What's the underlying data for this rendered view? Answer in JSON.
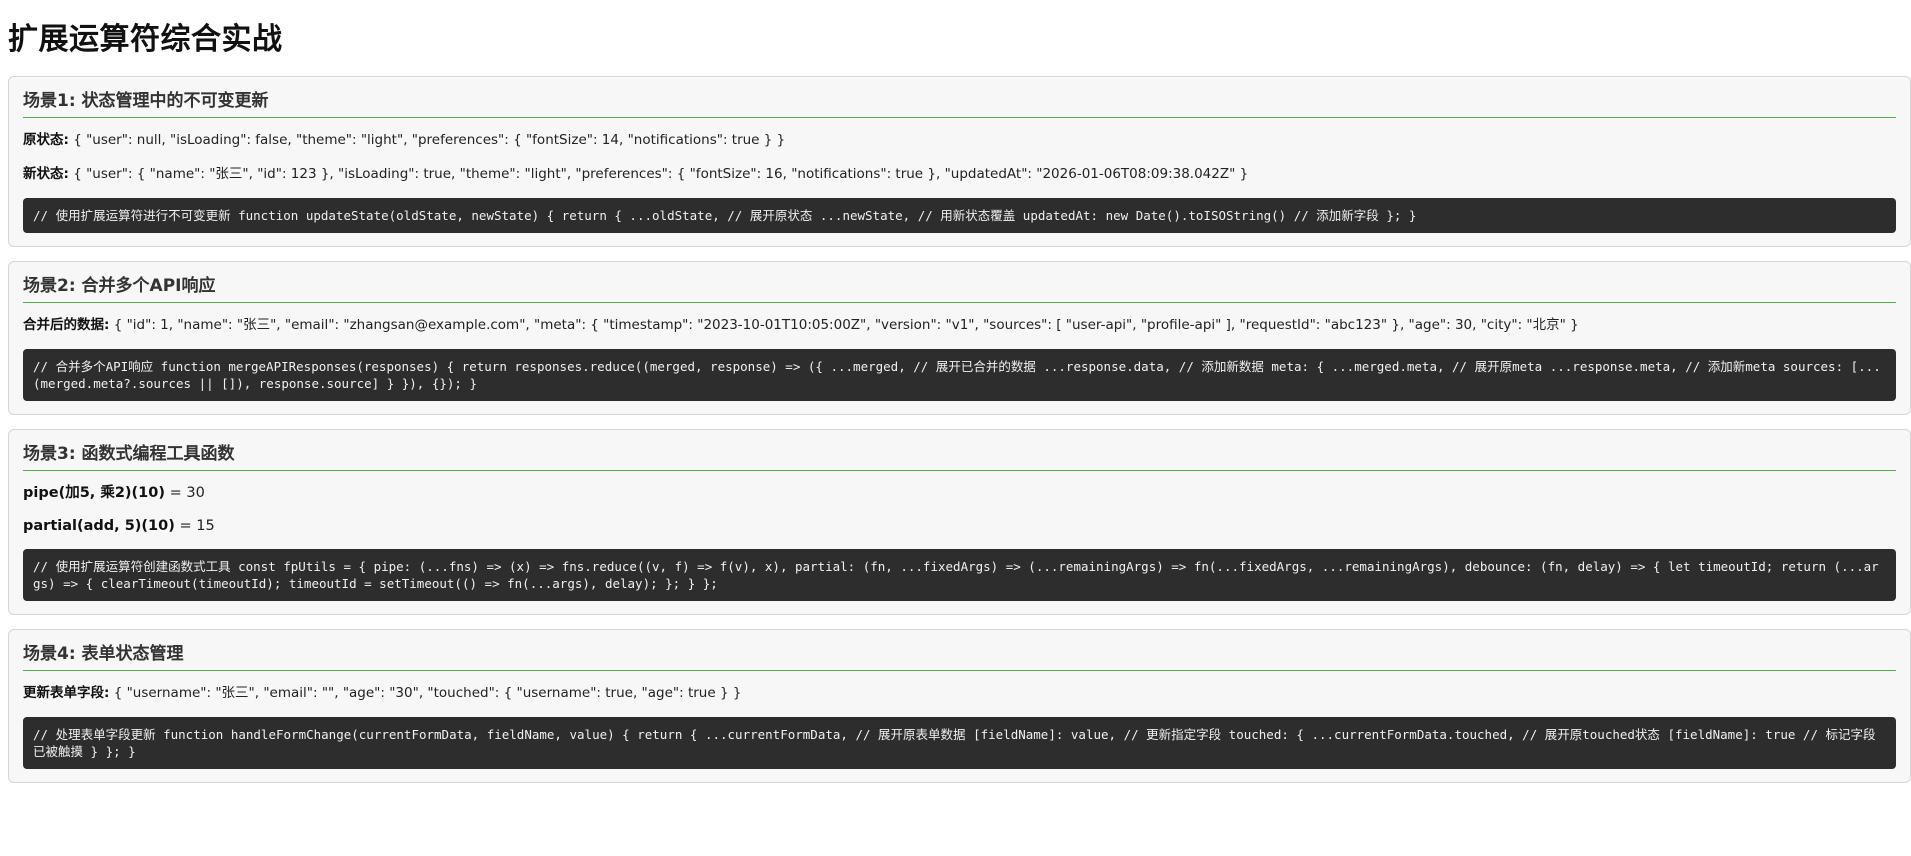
{
  "page": {
    "title": "扩展运算符综合实战"
  },
  "sections": [
    {
      "title": "场景1: 状态管理中的不可变更新",
      "rows": [
        {
          "label": "原状态:",
          "value": " { \"user\": null, \"isLoading\": false, \"theme\": \"light\", \"preferences\": { \"fontSize\": 14, \"notifications\": true } }"
        },
        {
          "label": "新状态:",
          "value": " { \"user\": { \"name\": \"张三\", \"id\": 123 }, \"isLoading\": true, \"theme\": \"light\", \"preferences\": { \"fontSize\": 16, \"notifications\": true }, \"updatedAt\": \"2026-01-06T08:09:38.042Z\" }"
        }
      ],
      "code": "// 使用扩展运算符进行不可变更新 function updateState(oldState, newState) { return { ...oldState, // 展开原状态 ...newState, // 用新状态覆盖 updatedAt: new Date().toISOString() // 添加新字段 }; }"
    },
    {
      "title": "场景2: 合并多个API响应",
      "rows": [
        {
          "label": "合并后的数据:",
          "value": " { \"id\": 1, \"name\": \"张三\", \"email\": \"zhangsan@example.com\", \"meta\": { \"timestamp\": \"2023-10-01T10:05:00Z\", \"version\": \"v1\", \"sources\": [ \"user-api\", \"profile-api\" ], \"requestId\": \"abc123\" }, \"age\": 30, \"city\": \"北京\" }"
        }
      ],
      "code": "// 合并多个API响应 function mergeAPIResponses(responses) { return responses.reduce((merged, response) => ({ ...merged, // 展开已合并的数据 ...response.data, // 添加新数据 meta: { ...merged.meta, // 展开原meta ...response.meta, // 添加新meta sources: [...(merged.meta?.sources || []), response.source] } }), {}); }"
    },
    {
      "title": "场景3: 函数式编程工具函数",
      "calcs": [
        {
          "expr": "pipe(加5, 乘2)(10)",
          "result": " = 30"
        },
        {
          "expr": "partial(add, 5)(10)",
          "result": " = 15"
        }
      ],
      "code": "// 使用扩展运算符创建函数式工具 const fpUtils = { pipe: (...fns) => (x) => fns.reduce((v, f) => f(v), x), partial: (fn, ...fixedArgs) => (...remainingArgs) => fn(...fixedArgs, ...remainingArgs), debounce: (fn, delay) => { let timeoutId; return (...args) => { clearTimeout(timeoutId); timeoutId = setTimeout(() => fn(...args), delay); }; } };"
    },
    {
      "title": "场景4: 表单状态管理",
      "rows": [
        {
          "label": "更新表单字段:",
          "value": " { \"username\": \"张三\", \"email\": \"\", \"age\": \"30\", \"touched\": { \"username\": true, \"age\": true } }"
        }
      ],
      "code": "// 处理表单字段更新 function handleFormChange(currentFormData, fieldName, value) { return { ...currentFormData, // 展开原表单数据 [fieldName]: value, // 更新指定字段 touched: { ...currentFormData.touched, // 展开原touched状态 [fieldName]: true // 标记字段已被触摸 } }; }"
    }
  ]
}
